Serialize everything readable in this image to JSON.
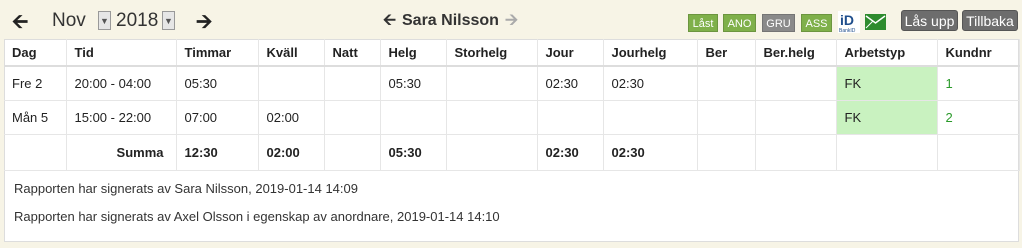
{
  "header": {
    "month": "Nov",
    "year": "2018",
    "employee_name": "Sara Nilsson",
    "badges": [
      {
        "label": "Låst",
        "color": "#7fb04a"
      },
      {
        "label": "ANO",
        "color": "#7fb04a"
      },
      {
        "label": "GRU",
        "color": "#8a8a8a"
      },
      {
        "label": "ASS",
        "color": "#7fb04a"
      }
    ],
    "unlock_label": "Lås upp",
    "back_label": "Tillbaka"
  },
  "table": {
    "columns": [
      "Dag",
      "Tid",
      "Timmar",
      "Kväll",
      "Natt",
      "Helg",
      "Storhelg",
      "Jour",
      "Jourhelg",
      "Ber",
      "Ber.helg",
      "Arbetstyp",
      "Kundnr"
    ],
    "rows": [
      [
        "Fre 2",
        "20:00 - 04:00",
        "05:30",
        "",
        "",
        "05:30",
        "",
        "02:30",
        "02:30",
        "",
        "",
        "FK",
        "1"
      ],
      [
        "Mån 5",
        "15:00 - 22:00",
        "07:00",
        "02:00",
        "",
        "",
        "",
        "",
        "",
        "",
        "",
        "FK",
        "2"
      ]
    ],
    "summary": [
      "",
      "Summa",
      "12:30",
      "02:00",
      "",
      "05:30",
      "",
      "02:30",
      "02:30",
      "",
      "",
      "",
      ""
    ]
  },
  "signatures": [
    "Rapporten har signerats av Sara Nilsson, 2019-01-14 14:09",
    "Rapporten har signerats av Axel Olsson i egenskap av anordnare, 2019-01-14 14:10"
  ],
  "colors": {
    "background": "#f7f4e6",
    "green_cell": "#c9f2c0",
    "kundnr_text": "#2a9a2a",
    "badge_green": "#7fb04a",
    "badge_gray": "#8a8a8a",
    "button_gray": "#6d6d6d"
  }
}
